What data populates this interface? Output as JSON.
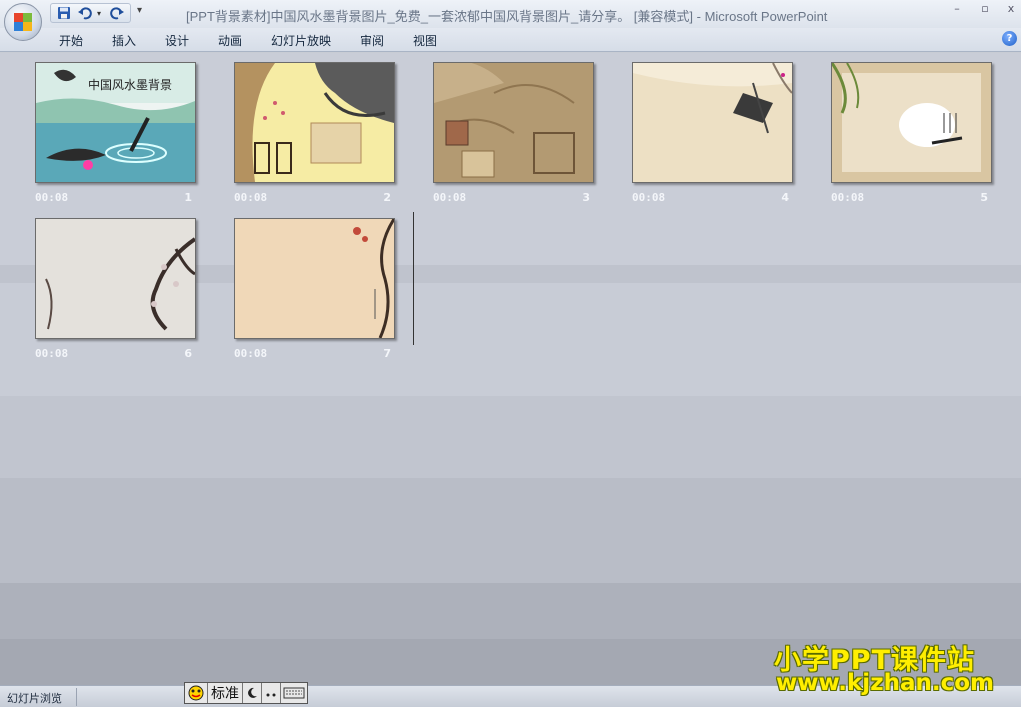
{
  "window": {
    "title": "[PPT背景素材]中国风水墨背景图片_免费_一套浓郁中国风背景图片_请分享。 [兼容模式] - Microsoft PowerPoint",
    "minimize": "–",
    "restore": "▫",
    "close": "x"
  },
  "quick_access": {
    "save_icon": "save-icon",
    "undo_icon": "undo-icon",
    "redo_icon": "redo-icon",
    "more": "▾"
  },
  "ribbon_tabs": [
    "开始",
    "插入",
    "设计",
    "动画",
    "幻灯片放映",
    "审阅",
    "视图"
  ],
  "help": "?",
  "slide_title_text": "中国风水墨背景",
  "slides": [
    {
      "time": "00:08",
      "number": "1"
    },
    {
      "time": "00:08",
      "number": "2"
    },
    {
      "time": "00:08",
      "number": "3"
    },
    {
      "time": "00:08",
      "number": "4"
    },
    {
      "time": "00:08",
      "number": "5"
    },
    {
      "time": "00:08",
      "number": "6"
    },
    {
      "time": "00:08",
      "number": "7"
    }
  ],
  "status": {
    "view_label": "幻灯片浏览"
  },
  "ime": {
    "mode": "标准",
    "icon": "ime-logo-icon"
  },
  "watermark": {
    "line1": "小学PPT课件站",
    "line2": "www.kjzhan.com"
  }
}
